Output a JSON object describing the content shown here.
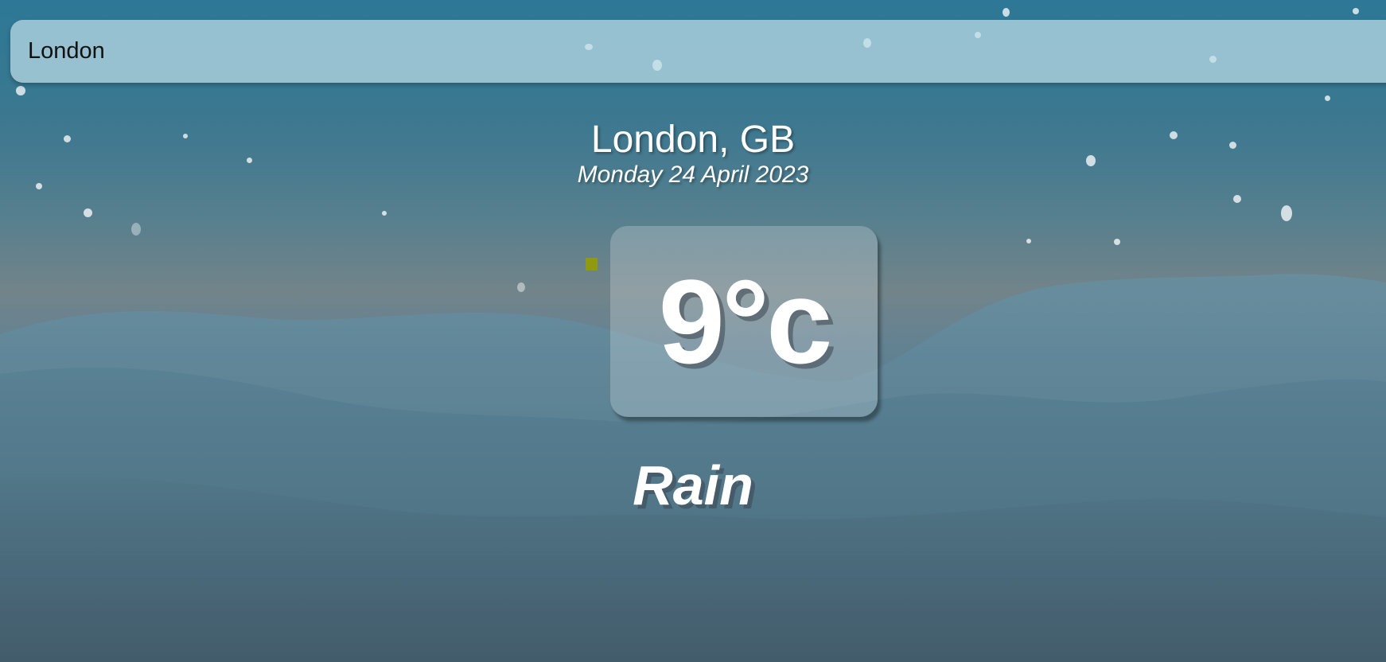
{
  "search": {
    "value": "London"
  },
  "weather": {
    "location": "London, GB",
    "date": "Monday 24 April 2023",
    "temperature": "9°c",
    "condition": "Rain"
  },
  "colors": {
    "text": "#ffffff",
    "search_bg": "#bedee8",
    "marker": "#8f9a10"
  }
}
